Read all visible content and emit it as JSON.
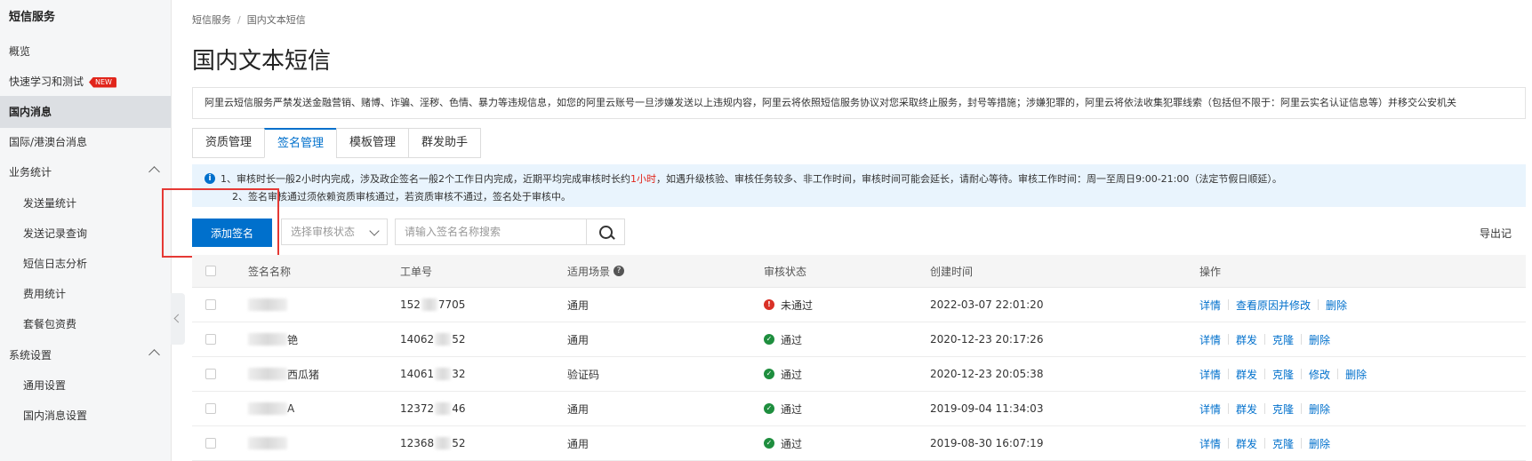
{
  "sidebar": {
    "title": "短信服务",
    "items": [
      {
        "label": "概览"
      },
      {
        "label": "快速学习和测试",
        "badge": "NEW"
      },
      {
        "label": "国内消息"
      },
      {
        "label": "国际/港澳台消息"
      },
      {
        "label": "业务统计"
      },
      {
        "label": "发送量统计"
      },
      {
        "label": "发送记录查询"
      },
      {
        "label": "短信日志分析"
      },
      {
        "label": "费用统计"
      },
      {
        "label": "套餐包资费"
      },
      {
        "label": "系统设置"
      },
      {
        "label": "通用设置"
      },
      {
        "label": "国内消息设置"
      }
    ]
  },
  "breadcrumb": {
    "root": "短信服务",
    "separator": "/",
    "current": "国内文本短信"
  },
  "page_title": "国内文本短信",
  "notice": "阿里云短信服务严禁发送金融营销、赌博、诈骗、淫秽、色情、暴力等违规信息，如您的阿里云账号一旦涉嫌发送以上违规内容，阿里云将依照短信服务协议对您采取终止服务，封号等措施；涉嫌犯罪的，阿里云将依法收集犯罪线索（包括但不限于：阿里云实名认证信息等）并移交公安机关",
  "tabs": [
    {
      "label": "资质管理"
    },
    {
      "label": "签名管理"
    },
    {
      "label": "模板管理"
    },
    {
      "label": "群发助手"
    }
  ],
  "tip": {
    "line1_pre": "1、审核时长一般2小时内完成，涉及政企签名一般2个工作日内完成，近期平均完成审核时长约",
    "line1_highlight": "1小时",
    "line1_post": "，如遇升级核验、审核任务较多、非工作时间，审核时间可能会延长，请耐心等待。审核工作时间：周一至周日9:00-21:00（法定节假日顺延）。",
    "line2": "2、签名审核通过须依赖资质审核通过，若资质审核不通过，签名处于审核中。"
  },
  "toolbar": {
    "add_label": "添加签名",
    "status_placeholder": "选择审核状态",
    "search_placeholder": "请输入签名名称搜索",
    "export_label": "导出记"
  },
  "table": {
    "headers": [
      "签名名称",
      "工单号",
      "适用场景",
      "审核状态",
      "创建时间",
      "操作"
    ],
    "rows": [
      {
        "name": "",
        "order_a": "152",
        "order_b": "7705",
        "scene": "通用",
        "status": "未通过",
        "status_kind": "fail",
        "created": "2022-03-07 22:01:20",
        "actions": [
          "详情",
          "查看原因并修改",
          "删除"
        ]
      },
      {
        "name": "铯",
        "order_a": "14062",
        "order_b": "52",
        "scene": "通用",
        "status": "通过",
        "status_kind": "ok",
        "created": "2020-12-23 20:17:26",
        "actions": [
          "详情",
          "群发",
          "克隆",
          "删除"
        ]
      },
      {
        "name": "西瓜猪",
        "order_a": "14061",
        "order_b": "32",
        "scene": "验证码",
        "status": "通过",
        "status_kind": "ok",
        "created": "2020-12-23 20:05:38",
        "actions": [
          "详情",
          "群发",
          "克隆",
          "修改",
          "删除"
        ]
      },
      {
        "name": "A",
        "order_a": "12372",
        "order_b": "46",
        "scene": "通用",
        "status": "通过",
        "status_kind": "ok",
        "created": "2019-09-04 11:34:03",
        "actions": [
          "详情",
          "群发",
          "克隆",
          "删除"
        ]
      },
      {
        "name": "",
        "order_a": "12368",
        "order_b": "52",
        "scene": "通用",
        "status": "通过",
        "status_kind": "ok",
        "created": "2019-08-30 16:07:19",
        "actions": [
          "详情",
          "群发",
          "克隆",
          "删除"
        ]
      }
    ]
  },
  "colors": {
    "accent": "#0070cc",
    "danger": "#d93026",
    "success": "#1e8e3e",
    "highlight_box": "#e53935"
  },
  "icons": {
    "info": "info-icon",
    "help": "help-icon",
    "search": "search-icon",
    "ok": "check-circle-icon",
    "fail": "error-circle-icon"
  }
}
